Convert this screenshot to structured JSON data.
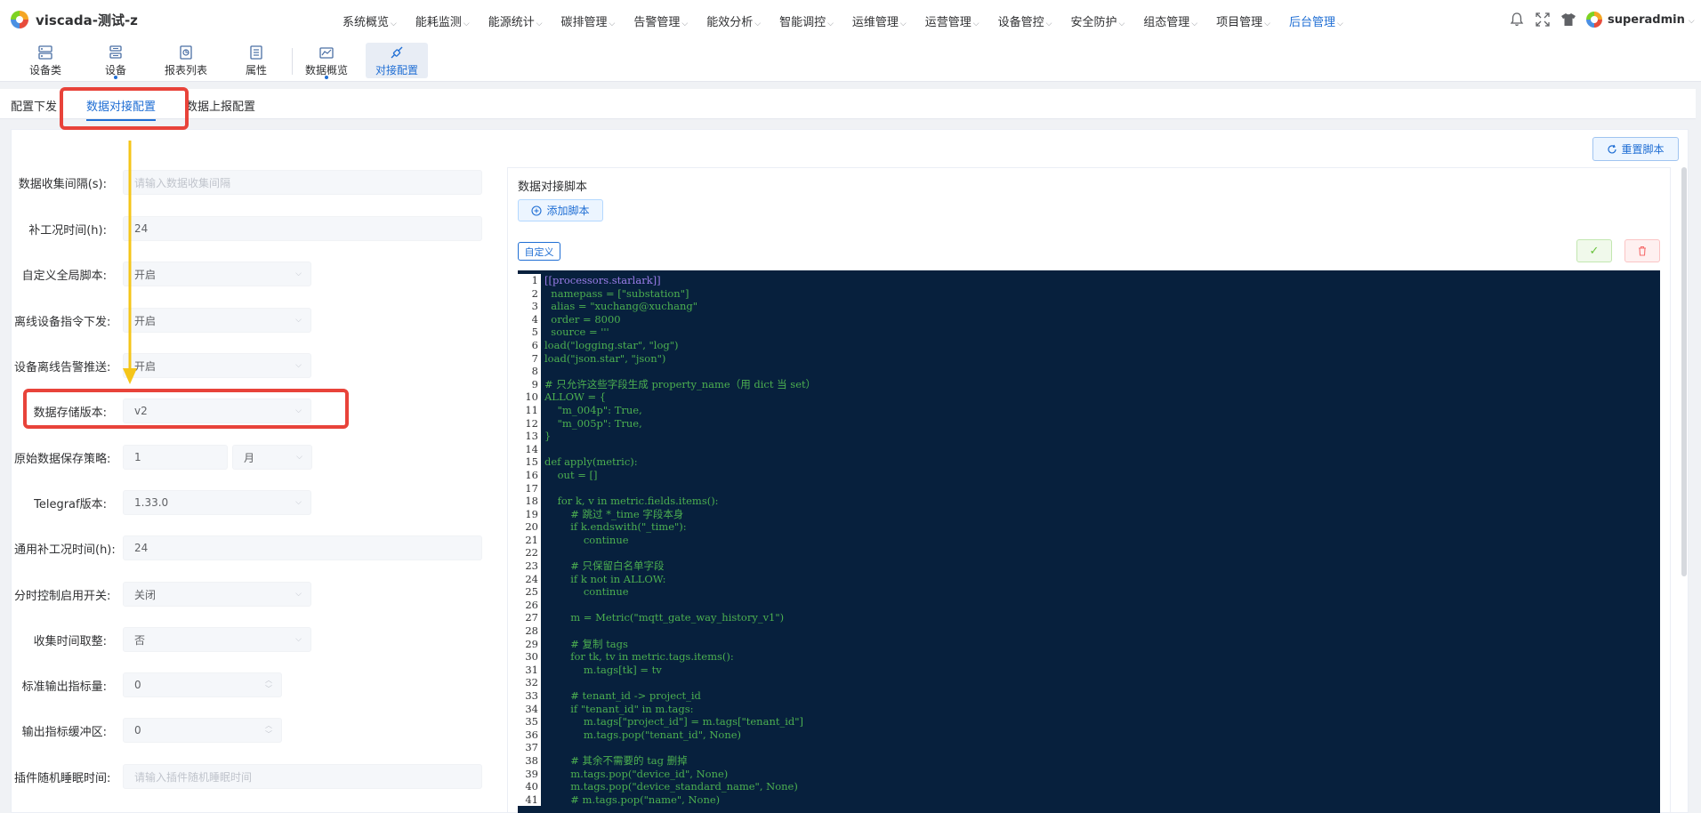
{
  "header": {
    "app_title": "viscada-测试-z",
    "nav": [
      {
        "label": "系统概览"
      },
      {
        "label": "能耗监测"
      },
      {
        "label": "能源统计"
      },
      {
        "label": "碳排管理"
      },
      {
        "label": "告警管理"
      },
      {
        "label": "能效分析"
      },
      {
        "label": "智能调控"
      },
      {
        "label": "运维管理"
      },
      {
        "label": "运营管理"
      },
      {
        "label": "设备管控"
      },
      {
        "label": "安全防护"
      },
      {
        "label": "组态管理"
      },
      {
        "label": "项目管理"
      },
      {
        "label": "后台管理"
      }
    ],
    "user": "superadmin",
    "icons": [
      "bell-icon",
      "fullscreen-icon",
      "theme-shirt-icon"
    ]
  },
  "toolbar": {
    "items": [
      {
        "label": "设备类",
        "icon": "device-class-icon"
      },
      {
        "label": "设备",
        "icon": "device-icon"
      },
      {
        "label": "报表列表",
        "icon": "report-icon"
      },
      {
        "label": "属性",
        "icon": "property-icon"
      },
      {
        "label": "数据概览",
        "icon": "data-overview-icon"
      },
      {
        "label": "对接配置",
        "icon": "integration-icon"
      }
    ]
  },
  "subtabs": [
    "配置下发",
    "数据对接配置",
    "数据上报配置"
  ],
  "reset_button": "重置脚本",
  "form": {
    "collect_interval": {
      "label": "数据收集间隔(s):",
      "placeholder": "请输入数据收集间隔"
    },
    "backfill_time": {
      "label": "补工况时间(h):",
      "value": "24"
    },
    "custom_global_script": {
      "label": "自定义全局脚本:",
      "value": "开启"
    },
    "offline_cmd": {
      "label": "离线设备指令下发:",
      "value": "开启"
    },
    "offline_alarm": {
      "label": "设备离线告警推送:",
      "value": "开启"
    },
    "storage_version": {
      "label": "数据存储版本:",
      "value": "v2"
    },
    "retention": {
      "label": "原始数据保存策略:",
      "value": "1",
      "unit": "月"
    },
    "telegraf_version": {
      "label": "Telegraf版本:",
      "value": "1.33.0"
    },
    "general_backfill": {
      "label": "通用补工况时间(h):",
      "value": "24"
    },
    "timeshare_switch": {
      "label": "分时控制启用开关:",
      "value": "关闭"
    },
    "collect_rounding": {
      "label": "收集时间取整:",
      "value": "否"
    },
    "std_output_metrics": {
      "label": "标准输出指标量:",
      "value": "0"
    },
    "output_buffer": {
      "label": "输出指标缓冲区:",
      "value": "0"
    },
    "plugin_sleep": {
      "label": "插件随机睡眠时间:",
      "placeholder": "请输入插件随机睡眠时间"
    }
  },
  "script": {
    "title": "数据对接脚本",
    "add_button": "添加脚本",
    "custom_tag": "自定义",
    "line_numbers": [
      "1",
      "2",
      "3",
      "4",
      "5",
      "6",
      "7",
      "8",
      "9",
      "10",
      "11",
      "12",
      "13",
      "14",
      "15",
      "16",
      "17",
      "18",
      "19",
      "20",
      "21",
      "22",
      "23",
      "24",
      "25",
      "26",
      "27",
      "28",
      "29",
      "30",
      "31",
      "32",
      "33",
      "34",
      "35",
      "36",
      "37",
      "38",
      "39",
      "40",
      "41"
    ],
    "lines": [
      "[[processors.starlark]]",
      "  namepass = [\"substation\"]",
      "  alias = \"xuchang@xuchang\"",
      "  order = 8000",
      "  source = '''",
      "load(\"logging.star\", \"log\")",
      "load(\"json.star\", \"json\")",
      "",
      "# 只允许这些字段生成 property_name（用 dict 当 set）",
      "ALLOW = {",
      "    \"m_004p\": True,",
      "    \"m_005p\": True,",
      "}",
      "",
      "def apply(metric):",
      "    out = []",
      "",
      "    for k, v in metric.fields.items():",
      "        # 跳过 *_time 字段本身",
      "        if k.endswith(\"_time\"):",
      "            continue",
      "",
      "        # 只保留白名单字段",
      "        if k not in ALLOW:",
      "            continue",
      "",
      "        m = Metric(\"mqtt_gate_way_history_v1\")",
      "",
      "        # 复制 tags",
      "        for tk, tv in metric.tags.items():",
      "            m.tags[tk] = tv",
      "",
      "        # tenant_id -> project_id",
      "        if \"tenant_id\" in m.tags:",
      "            m.tags[\"project_id\"] = m.tags[\"tenant_id\"]",
      "            m.tags.pop(\"tenant_id\", None)",
      "",
      "        # 其余不需要的 tag 删掉",
      "        m.tags.pop(\"device_id\", None)",
      "        m.tags.pop(\"device_standard_name\", None)",
      "        # m.tags.pop(\"name\", None)"
    ]
  }
}
